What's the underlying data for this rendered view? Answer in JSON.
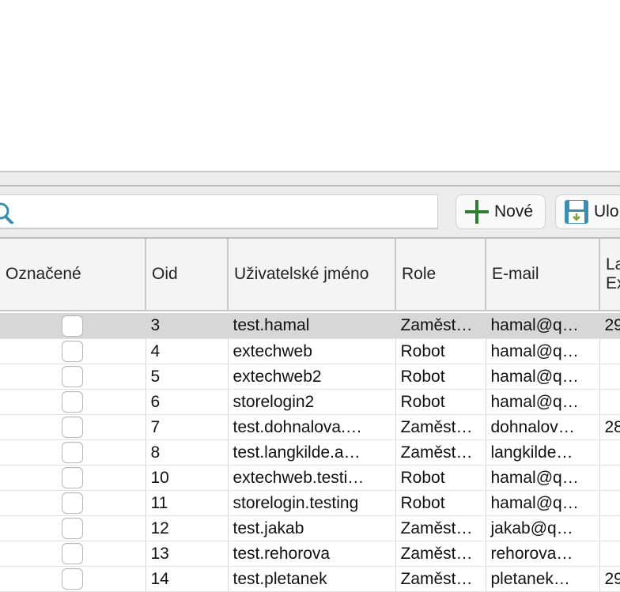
{
  "toolbar": {
    "search_placeholder": "",
    "new_label": "Nové",
    "save_label": "Ulo"
  },
  "table": {
    "columns": [
      "Označené",
      "Oid",
      "Uživatelské jméno",
      "Role",
      "E-mail",
      "La Ex"
    ],
    "rows": [
      {
        "checked": false,
        "oid": "3",
        "username": "test.hamal",
        "role": "Zaměst…",
        "email": "hamal@q…",
        "last": "29",
        "selected": true
      },
      {
        "checked": false,
        "oid": "4",
        "username": "extechweb",
        "role": "Robot",
        "email": "hamal@q…",
        "last": ""
      },
      {
        "checked": false,
        "oid": "5",
        "username": "extechweb2",
        "role": "Robot",
        "email": "hamal@q…",
        "last": ""
      },
      {
        "checked": false,
        "oid": "6",
        "username": "storelogin2",
        "role": "Robot",
        "email": "hamal@q…",
        "last": ""
      },
      {
        "checked": false,
        "oid": "7",
        "username": "test.dohnalova.…",
        "role": "Zaměst…",
        "email": "dohnalov…",
        "last": "28"
      },
      {
        "checked": false,
        "oid": "8",
        "username": "test.langkilde.a…",
        "role": "Zaměst…",
        "email": "langkilde…",
        "last": ""
      },
      {
        "checked": false,
        "oid": "10",
        "username": "extechweb.testi…",
        "role": "Robot",
        "email": "hamal@q…",
        "last": ""
      },
      {
        "checked": false,
        "oid": "11",
        "username": "storelogin.testing",
        "role": "Robot",
        "email": "hamal@q…",
        "last": ""
      },
      {
        "checked": false,
        "oid": "12",
        "username": "test.jakab",
        "role": "Zaměst…",
        "email": "jakab@q…",
        "last": ""
      },
      {
        "checked": false,
        "oid": "13",
        "username": "test.rehorova",
        "role": "Zaměst…",
        "email": "rehorova…",
        "last": ""
      },
      {
        "checked": false,
        "oid": "14",
        "username": "test.pletanek",
        "role": "Zaměst…",
        "email": "pletanek…",
        "last": "29"
      }
    ]
  },
  "colors": {
    "toolbar_bg": "#ececec",
    "selected_row": "#d7d7d7",
    "search_icon": "#3a8fb0",
    "plus_icon": "#2e7d32"
  }
}
